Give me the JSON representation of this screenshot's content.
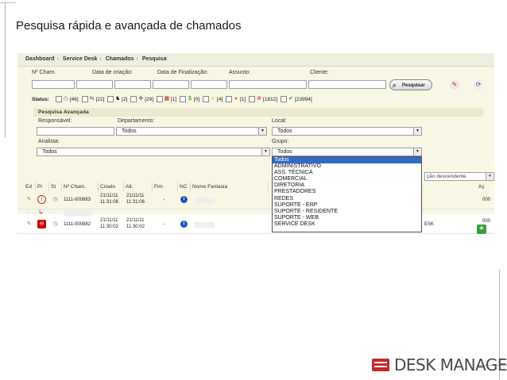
{
  "slide": {
    "title": "Pesquisa rápida e avançada de chamados"
  },
  "breadcrumb": [
    "Dashboard",
    "Service Desk",
    "Chamados",
    "Pesquisa"
  ],
  "quick_search": {
    "labels": {
      "num": "Nº Cham.",
      "created": "Data de criação:",
      "finished": "Data de Finalização:",
      "subject": "Assunto:",
      "client": "Cliente:"
    },
    "button": "Pesquisar"
  },
  "status": {
    "label": "Status:",
    "counts": [
      "[46]",
      "[22]",
      "[2]",
      "[29]",
      "[1]",
      "[0]",
      "[4]",
      "[1]",
      "[1812]",
      "[23994]"
    ]
  },
  "advanced": {
    "header": "Pesquisa Avançada",
    "labels": {
      "responsible": "Responsável:",
      "department": "Departamento:",
      "local": "Local:",
      "analyst": "Analista:",
      "group": "Grupo:"
    },
    "values": {
      "department": "Todos",
      "local": "Todos",
      "analyst": "Todos",
      "group": "Todos"
    }
  },
  "group_dropdown": {
    "options": [
      "Todos",
      "ADMINISTRATIVO",
      "ASS. TÉCNICA",
      "COMERCIAL",
      "DIRETORIA",
      "PRESTADORES",
      "REDES",
      "SUPORTE - ERP",
      "SUPORTE - RESIDENTE",
      "SUPORTE - WEB",
      "SERVICE DESK"
    ],
    "highlighted": "Todos"
  },
  "order_select": {
    "value": "ção descendente"
  },
  "table": {
    "headers": [
      "Ed",
      "Pr",
      "St",
      "Nº Cham.",
      "Criado",
      "Alt.",
      "Fim",
      "NC",
      "Nome Fantasia",
      "Aç"
    ],
    "rows": [
      {
        "num": "1111-000883",
        "created_date": "21/11/11",
        "created_time": "11:31:06",
        "alt_date": "21/11/11",
        "alt_time": "11:31:06",
        "fim": "-",
        "tail": "000"
      },
      {
        "num": "1111-000882",
        "created_date": "21/11/11",
        "created_time": "11:30:02",
        "alt_date": "21/11/11",
        "alt_time": "11:30:02",
        "fim": "-",
        "tail": "000",
        "desk_tail": "ESK"
      }
    ]
  },
  "colors": {
    "highlight": "#3169c6",
    "panel": "#f8f6e4",
    "brand_red": "#c62828"
  },
  "logo": {
    "text": "DESK MANAGER"
  }
}
